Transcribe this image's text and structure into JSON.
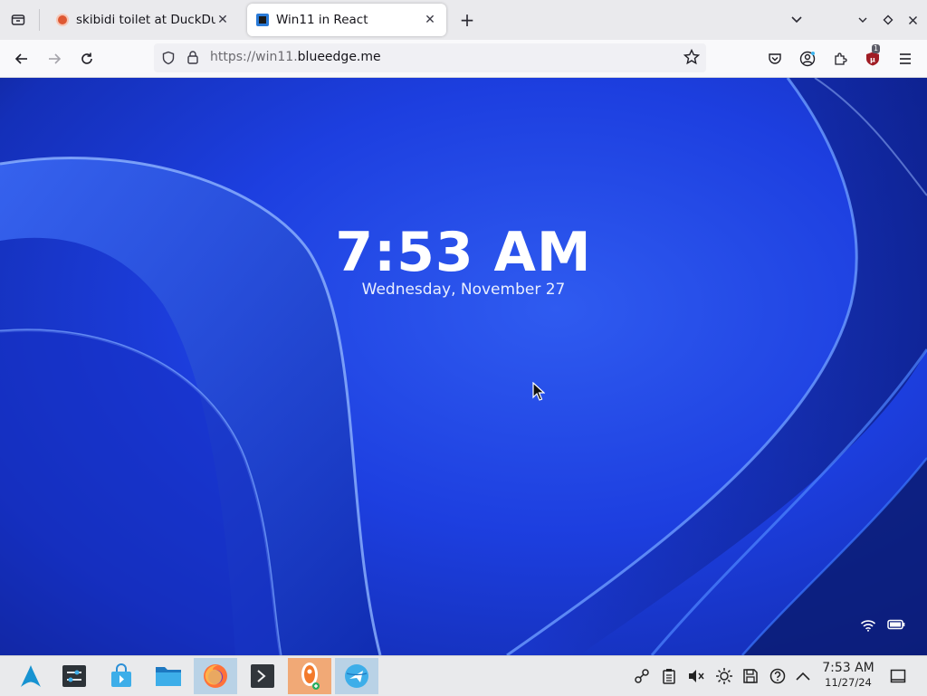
{
  "browser": {
    "tabs": [
      {
        "title": "skibidi toilet at DuckDuckGo",
        "active": false
      },
      {
        "title": "Win11 in React",
        "active": true
      }
    ],
    "url_prefix": "https://win11.",
    "url_domain": "blueedge.me",
    "extension_badge": "1"
  },
  "lockscreen": {
    "time": "7:53 AM",
    "date": "Wednesday, November 27"
  },
  "taskbar": {
    "time": "7:53 AM",
    "date": "11/27/24"
  },
  "colors": {
    "wallpaper": "#1d3fe0",
    "taskbar": "#e9eaec",
    "active_task": "#b9d2e6",
    "ublock_red": "#a01c24"
  }
}
